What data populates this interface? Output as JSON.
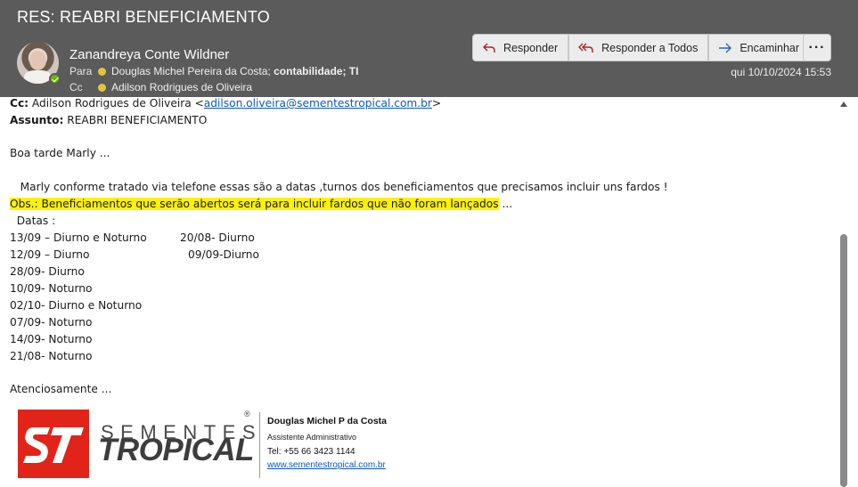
{
  "header": {
    "subject": "RES: REABRI BENEFICIAMENTO",
    "sender": "Zanandreya Conte Wildner",
    "to_label": "Para",
    "to_recipients": "Douglas Michel Pereira da Costa;",
    "to_bold": "contabilidade; TI",
    "cc_label": "Cc",
    "cc_recipients": "Adilson Rodrigues de Oliveira",
    "date": "qui 10/10/2024 15:53"
  },
  "actions": {
    "reply": "Responder",
    "reply_all": "Responder a Todos",
    "forward": "Encaminhar",
    "more": "···"
  },
  "body": {
    "cc_label": "Cc:",
    "cc_name": "Adilson Rodrigues de Oliveira <",
    "cc_email": "adilson.oliveira@sementestropical.com.br",
    "cc_close": ">",
    "subject_label": "Assunto:",
    "subject_value": "REABRI BENEFICIAMENTO",
    "greeting": "Boa tarde Marly ...",
    "paragraph": "   Marly conforme tratado via telefone essas são a datas ,turnos dos beneficiamentos que precisamos incluir uns fardos !",
    "obs_highlight": "Obs.: Beneficiamentos que serão abertos será para incluir fardos que não foram lançados",
    "obs_tail": " ...",
    "dates_title": "  Datas :",
    "dates_left": [
      "13/09 – Diurno e Noturno",
      "12/09 – Diurno",
      "28/09- Diurno",
      "10/09- Noturno",
      "02/10- Diurno e Noturno",
      "07/09- Noturno",
      "14/09- Noturno",
      "21/08- Noturno"
    ],
    "dates_right": [
      "20/08- Diurno",
      "09/09-Diurno"
    ],
    "closing": "Atenciosamente ..."
  },
  "signature": {
    "logo_top": "SEMENTES",
    "logo_bottom": "TROPICAL",
    "registered": "®",
    "name": "Douglas Michel P da Costa",
    "role": "Assistente Administrativo",
    "phone": "Tel: +55 66 3423 1144",
    "website": "www.sementestropical.com.br"
  },
  "colors": {
    "header_bg": "#5b5b5b",
    "highlight": "#fff200",
    "brand_red": "#e2231a",
    "link": "#0a58ca",
    "presence": "#6bb700"
  }
}
